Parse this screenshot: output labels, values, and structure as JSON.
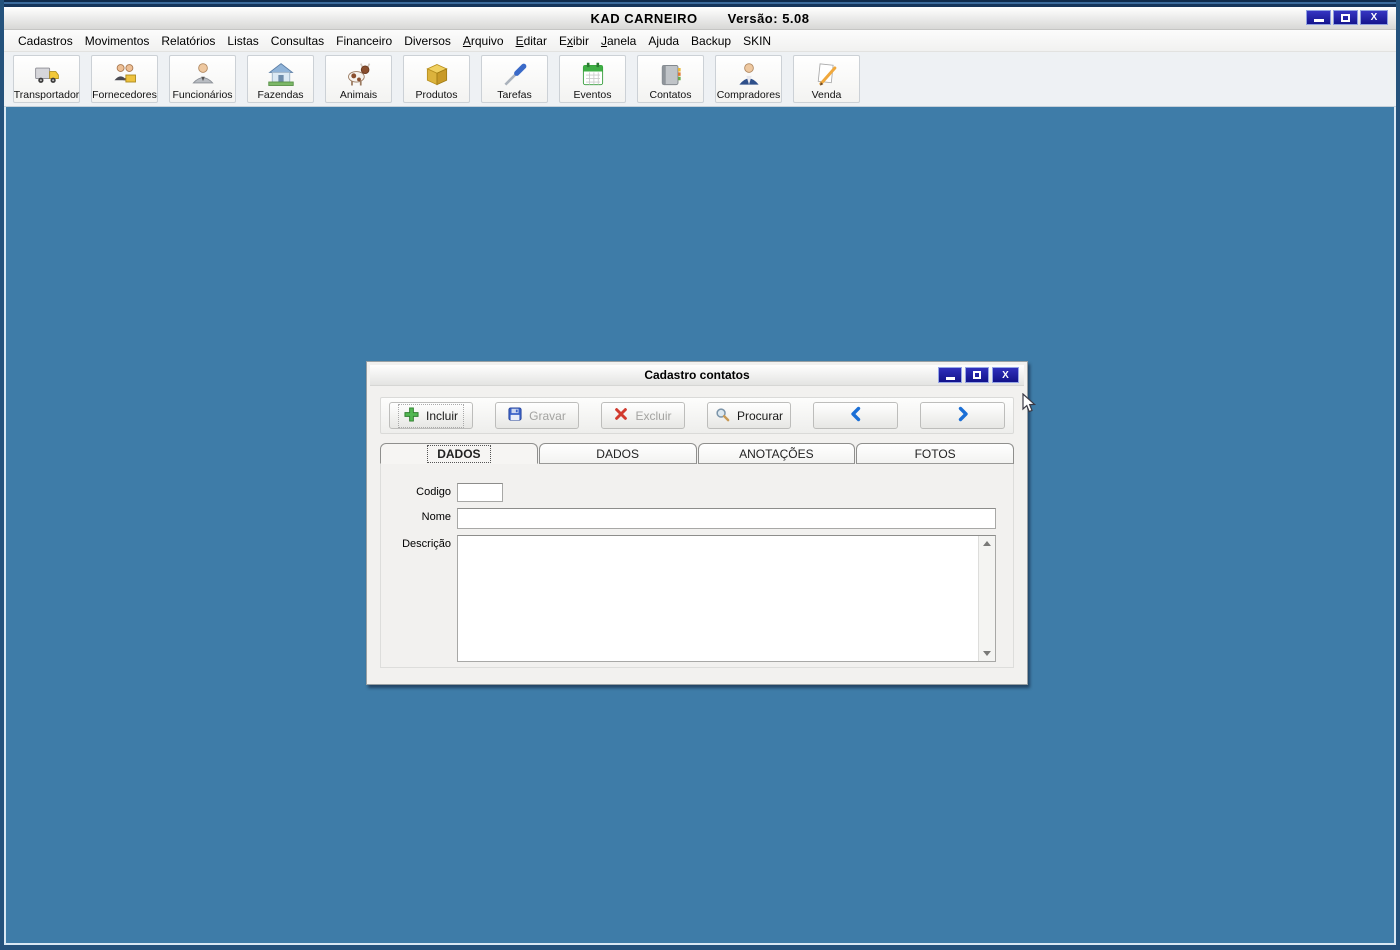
{
  "app": {
    "title": "KAD CARNEIRO",
    "version_label": "Versão: 5.08",
    "window_controls": {
      "close_glyph": "X"
    }
  },
  "menu": {
    "items": [
      {
        "pre": "Cadastros",
        "key": "",
        "post": ""
      },
      {
        "pre": "Movimentos",
        "key": "",
        "post": ""
      },
      {
        "pre": "Relatórios",
        "key": "",
        "post": ""
      },
      {
        "pre": "Listas",
        "key": "",
        "post": ""
      },
      {
        "pre": "Consultas",
        "key": "",
        "post": ""
      },
      {
        "pre": "Financeiro",
        "key": "",
        "post": ""
      },
      {
        "pre": "Diversos",
        "key": "",
        "post": ""
      },
      {
        "pre": "",
        "key": "A",
        "post": "rquivo"
      },
      {
        "pre": "",
        "key": "E",
        "post": "ditar"
      },
      {
        "pre": "E",
        "key": "x",
        "post": "ibir"
      },
      {
        "pre": "",
        "key": "J",
        "post": "anela"
      },
      {
        "pre": "Ajuda",
        "key": "",
        "post": ""
      },
      {
        "pre": "Backup",
        "key": "",
        "post": ""
      },
      {
        "pre": "SKIN",
        "key": "",
        "post": ""
      }
    ]
  },
  "toolbar": {
    "buttons": [
      {
        "label": "Transportador",
        "icon": "truck-icon"
      },
      {
        "label": "Fornecedores",
        "icon": "suppliers-icon"
      },
      {
        "label": "Funcionários",
        "icon": "employee-icon"
      },
      {
        "label": "Fazendas",
        "icon": "farm-house-icon"
      },
      {
        "label": "Animais",
        "icon": "cow-icon"
      },
      {
        "label": "Produtos",
        "icon": "box-icon"
      },
      {
        "label": "Tarefas",
        "icon": "screwdriver-icon"
      },
      {
        "label": "Eventos",
        "icon": "calendar-icon"
      },
      {
        "label": "Contatos",
        "icon": "address-book-icon"
      },
      {
        "label": "Compradores",
        "icon": "buyer-person-icon"
      },
      {
        "label": "Venda",
        "icon": "pencil-paper-icon"
      }
    ]
  },
  "dialog": {
    "title": "Cadastro contatos",
    "window_controls": {
      "close_glyph": "X"
    },
    "toolbar": {
      "buttons": [
        {
          "label": "Incluir",
          "icon": "plus-icon",
          "enabled": true
        },
        {
          "label": "Gravar",
          "icon": "floppy-icon",
          "enabled": false
        },
        {
          "label": "Excluir",
          "icon": "red-x-icon",
          "enabled": false
        },
        {
          "label": "Procurar",
          "icon": "magnifier-icon",
          "enabled": true
        }
      ],
      "nav": [
        {
          "icon": "chevron-left-icon"
        },
        {
          "icon": "chevron-right-icon"
        }
      ]
    },
    "tabs": [
      {
        "label": "DADOS",
        "selected": true
      },
      {
        "label": "DADOS",
        "selected": false
      },
      {
        "label": "ANOTAÇÕES",
        "selected": false
      },
      {
        "label": "FOTOS",
        "selected": false
      }
    ],
    "fields": {
      "codigo": {
        "label": "Codigo",
        "value": ""
      },
      "nome": {
        "label": "Nome",
        "value": ""
      },
      "descricao": {
        "label": "Descrição",
        "value": ""
      }
    }
  },
  "colors": {
    "mdi_background": "#3e7ca8",
    "frame_navy": "#24527c",
    "window_button_blue": "#1c1c9e",
    "incluir_green": "#52b852",
    "gravar_blue": "#3a62c8",
    "excluir_red": "#d23a2e",
    "chevron_blue": "#1b6fd6",
    "disabled_text": "#a3a3a1"
  }
}
